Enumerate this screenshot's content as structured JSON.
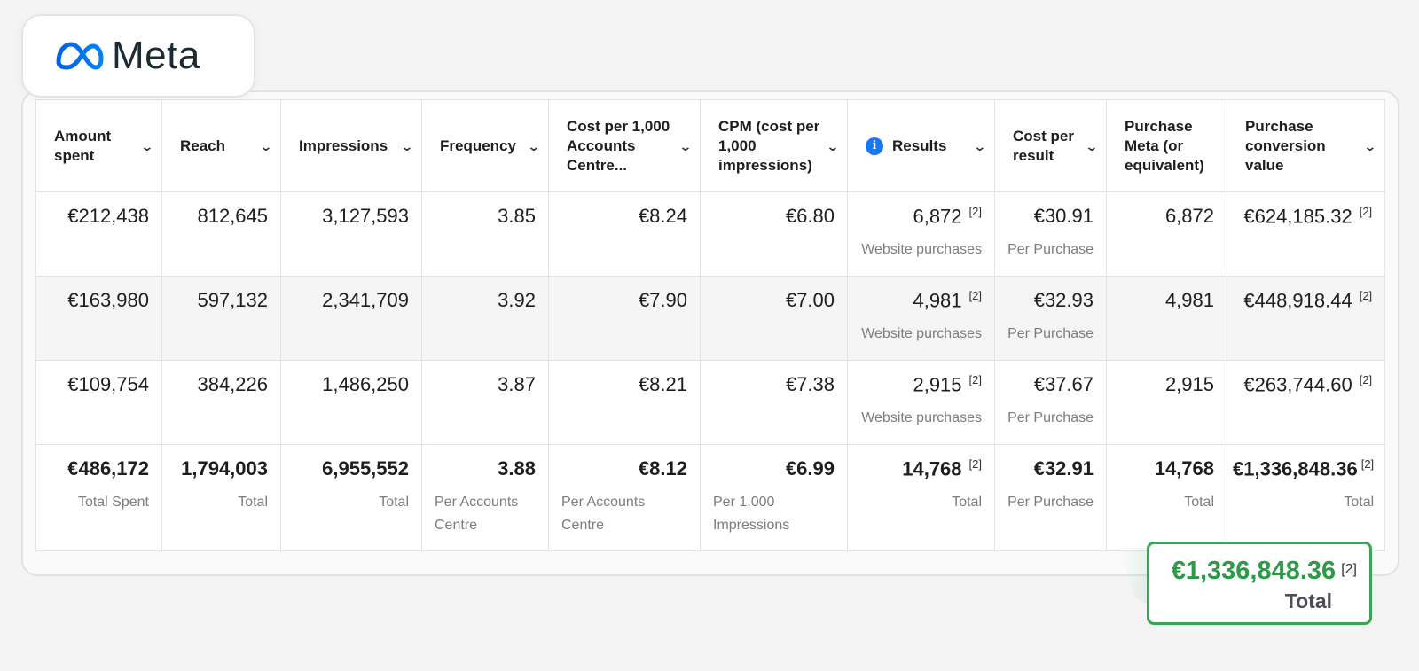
{
  "brand": {
    "name": "Meta",
    "logo_icon": "meta-infinity-icon",
    "accent": "#0668E1"
  },
  "columns": [
    {
      "label": "Amount spent"
    },
    {
      "label": "Reach"
    },
    {
      "label": "Impressions"
    },
    {
      "label": "Frequency"
    },
    {
      "label": "Cost per 1,000 Accounts Centre..."
    },
    {
      "label": "CPM (cost per 1,000 impressions)"
    },
    {
      "label": "Results",
      "icon": "info-icon"
    },
    {
      "label": "Cost per result"
    },
    {
      "label": "Purchase Meta (or equivalent)"
    },
    {
      "label": "Purchase conversion value"
    }
  ],
  "rows": [
    {
      "amount_spent": "€212,438",
      "reach": "812,645",
      "impressions": "3,127,593",
      "frequency": "3.85",
      "cost_per_1000_accounts": "€8.24",
      "cpm": "€6.80",
      "results": "6,872",
      "results_note": "[2]",
      "results_label": "Website purchases",
      "cost_per_result": "€30.91",
      "cost_per_result_label": "Per Purchase",
      "purchase_meta": "6,872",
      "conversion_value": "€624,185.32",
      "conversion_note": "[2]"
    },
    {
      "amount_spent": "€163,980",
      "reach": "597,132",
      "impressions": "2,341,709",
      "frequency": "3.92",
      "cost_per_1000_accounts": "€7.90",
      "cpm": "€7.00",
      "results": "4,981",
      "results_note": "[2]",
      "results_label": "Website purchases",
      "cost_per_result": "€32.93",
      "cost_per_result_label": "Per Purchase",
      "purchase_meta": "4,981",
      "conversion_value": "€448,918.44",
      "conversion_note": "[2]"
    },
    {
      "amount_spent": "€109,754",
      "reach": "384,226",
      "impressions": "1,486,250",
      "frequency": "3.87",
      "cost_per_1000_accounts": "€8.21",
      "cpm": "€7.38",
      "results": "2,915",
      "results_note": "[2]",
      "results_label": "Website purchases",
      "cost_per_result": "€37.67",
      "cost_per_result_label": "Per Purchase",
      "purchase_meta": "2,915",
      "conversion_value": "€263,744.60",
      "conversion_note": "[2]"
    }
  ],
  "totals": {
    "amount_spent": "€486,172",
    "amount_spent_label": "Total Spent",
    "reach": "1,794,003",
    "reach_label": "Total",
    "impressions": "6,955,552",
    "impressions_label": "Total",
    "frequency": "3.88",
    "frequency_label": "Per Accounts Centre",
    "cost_per_1000_accounts": "€8.12",
    "cost_per_1000_accounts_label": "Per Accounts Centre",
    "cpm": "€6.99",
    "cpm_label": "Per 1,000 Impressions",
    "results": "14,768",
    "results_note": "[2]",
    "results_label": "Total",
    "cost_per_result": "€32.91",
    "cost_per_result_label": "Per Purchase",
    "purchase_meta": "14,768",
    "purchase_meta_label": "Total",
    "conversion_value": "€1,336,848.36",
    "conversion_note": "[2]",
    "conversion_label": "Total"
  },
  "highlight": {
    "value": "€1,336,848.36",
    "note": "[2]",
    "label": "Total",
    "color": "#2e9a48"
  },
  "colors": {
    "info_icon": "#1877f2",
    "highlight_border": "#3aa655",
    "sub_text": "#7b7d80"
  }
}
